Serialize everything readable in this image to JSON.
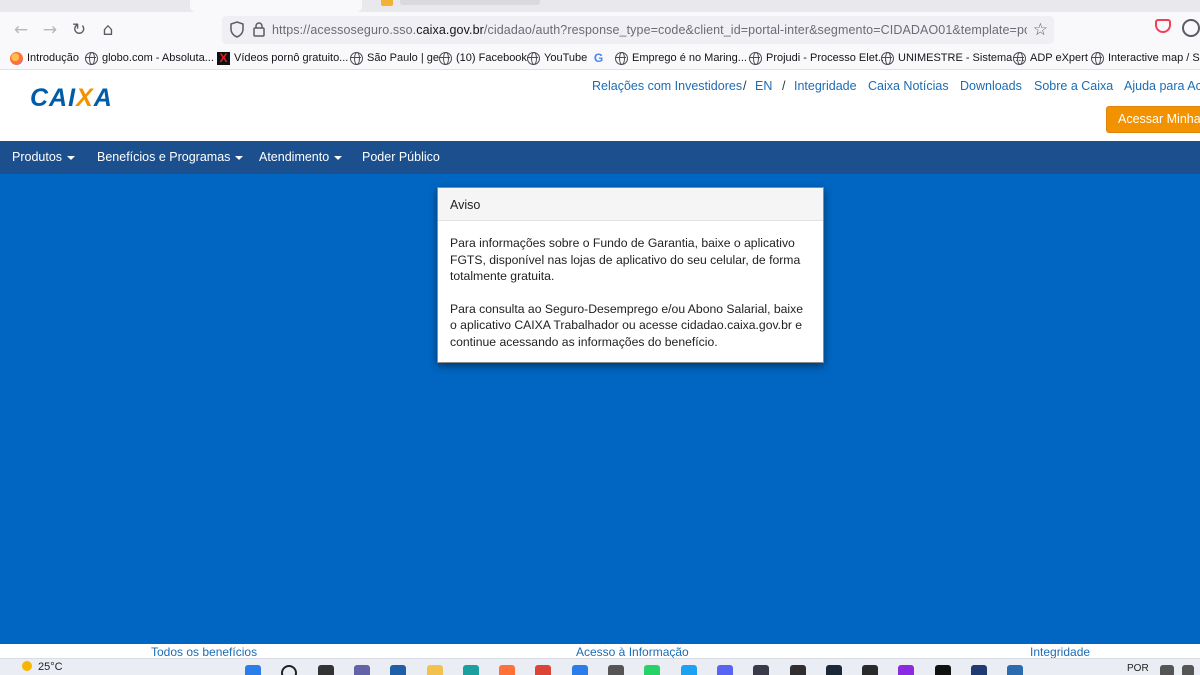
{
  "browser": {
    "url_prefix": "https://acessoseguro.sso.",
    "url_domain": "caixa.gov.br",
    "url_rest": "/cidadao/auth?response_type=code&client_id=portal-inter&segmento=CIDADAO01&template=portal&redirect"
  },
  "bookmarks": [
    {
      "label": "Introdução",
      "icon": "firefox-icon"
    },
    {
      "label": "globo.com - Absoluta...",
      "icon": "globe-icon"
    },
    {
      "label": "Vídeos pornô gratuito...",
      "icon": "x-icon"
    },
    {
      "label": "São Paulo | ge",
      "icon": "globe-icon"
    },
    {
      "label": "(10) Facebook",
      "icon": "globe-icon"
    },
    {
      "label": "YouTube",
      "icon": "globe-icon"
    },
    {
      "label": "",
      "icon": "google-icon"
    },
    {
      "label": "Emprego é no Maring...",
      "icon": "globe-icon"
    },
    {
      "label": "Projudi - Processo Elet...",
      "icon": "globe-icon"
    },
    {
      "label": "UNIMESTRE - Sistema ...",
      "icon": "globe-icon"
    },
    {
      "label": "ADP eXpert",
      "icon": "globe-icon"
    },
    {
      "label": "Interactive map / Sav",
      "icon": "globe-icon"
    }
  ],
  "site": {
    "logo": {
      "part1": "CAI",
      "part2": "X",
      "part3": "A"
    },
    "top_links": [
      "Relações com Investidores",
      "/",
      "EN",
      "/",
      "Integridade",
      "Caixa Notícias",
      "Downloads",
      "Sobre a Caixa",
      "Ajuda para Ace"
    ],
    "access_button": "Acessar Minha c",
    "menu": [
      {
        "label": "Produtos",
        "dropdown": true
      },
      {
        "label": "Benefícios e Programas",
        "dropdown": true
      },
      {
        "label": "Atendimento",
        "dropdown": true
      },
      {
        "label": "Poder Público",
        "dropdown": false
      }
    ],
    "footer_links": [
      "Todos os benefícios",
      "Acesso à Informação",
      "Integridade"
    ]
  },
  "modal": {
    "title": "Aviso",
    "paragraph1": "Para informações sobre o Fundo de Garantia, baixe o aplicativo FGTS, disponível nas lojas de aplicativo do seu celular, de forma totalmente gratuita.",
    "paragraph2": "Para consulta ao Seguro-Desemprego e/ou Abono Salarial, baixe o aplicativo CAIXA Trabalhador ou acesse cidadao.caixa.gov.br e continue acessando as informações do benefício."
  },
  "taskbar": {
    "temperature": "25°C",
    "language": "POR",
    "apps": [
      {
        "name": "windows-start-icon",
        "color": "#2b7de9"
      },
      {
        "name": "search-icon",
        "color": "#222222"
      },
      {
        "name": "task-view-icon",
        "color": "#333333"
      },
      {
        "name": "teams-icon",
        "color": "#6264a7"
      },
      {
        "name": "mail-icon",
        "color": "#1f5fa8"
      },
      {
        "name": "file-explorer-icon",
        "color": "#f2c14e"
      },
      {
        "name": "edge-icon",
        "color": "#1ba0a0"
      },
      {
        "name": "firefox-icon",
        "color": "#ff7139"
      },
      {
        "name": "chrome-icon",
        "color": "#db4437"
      },
      {
        "name": "store-icon",
        "color": "#2b7de9"
      },
      {
        "name": "settings-icon",
        "color": "#555555"
      },
      {
        "name": "whatsapp-icon",
        "color": "#25d366"
      },
      {
        "name": "twitter-icon",
        "color": "#1da1f2"
      },
      {
        "name": "discord-icon",
        "color": "#5865f2"
      },
      {
        "name": "app-icon",
        "color": "#3a3a4a"
      },
      {
        "name": "obs-icon",
        "color": "#302e31"
      },
      {
        "name": "steam-icon",
        "color": "#1b2838"
      },
      {
        "name": "epic-games-icon",
        "color": "#2a2a2a"
      },
      {
        "name": "circle-app-icon",
        "color": "#8a2be2"
      },
      {
        "name": "games-icon",
        "color": "#111111"
      },
      {
        "name": "tp-icon",
        "color": "#1f3b73"
      },
      {
        "name": "bug-icon",
        "color": "#2b6cb0"
      }
    ]
  }
}
